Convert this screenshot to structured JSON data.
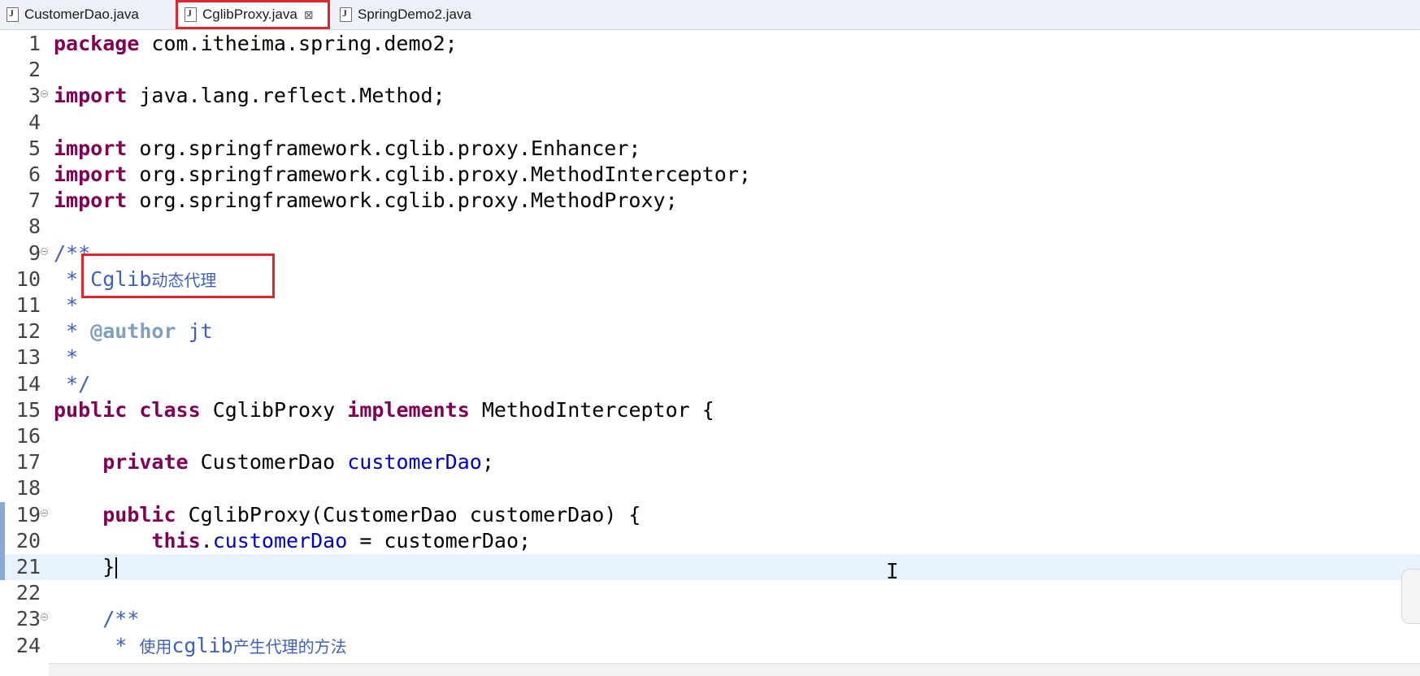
{
  "tabs": [
    {
      "label": "CustomerDao.java"
    },
    {
      "label": "CglibProxy.java",
      "close": "⊠"
    },
    {
      "label": "SpringDemo2.java"
    }
  ],
  "lines": [
    {
      "n": "1",
      "t": [
        [
          "kw",
          "package"
        ],
        [
          "p",
          " com.itheima.spring.demo2;"
        ]
      ]
    },
    {
      "n": "2",
      "t": []
    },
    {
      "n": "3",
      "t": [
        [
          "kw",
          "import"
        ],
        [
          "p",
          " java.lang.reflect.Method;"
        ]
      ]
    },
    {
      "n": "4",
      "t": []
    },
    {
      "n": "5",
      "t": [
        [
          "kw",
          "import"
        ],
        [
          "p",
          " org.springframework.cglib.proxy.Enhancer;"
        ]
      ]
    },
    {
      "n": "6",
      "t": [
        [
          "kw",
          "import"
        ],
        [
          "p",
          " org.springframework.cglib.proxy.MethodInterceptor;"
        ]
      ]
    },
    {
      "n": "7",
      "t": [
        [
          "kw",
          "import"
        ],
        [
          "p",
          " org.springframework.cglib.proxy.MethodProxy;"
        ]
      ]
    },
    {
      "n": "8",
      "t": []
    },
    {
      "n": "9",
      "t": [
        [
          "cmt",
          "/**"
        ]
      ]
    },
    {
      "n": "10",
      "t": [
        [
          "cmt",
          " * "
        ],
        [
          "cmt",
          "Cglib"
        ],
        [
          "cmtcjk",
          "动态代理"
        ]
      ]
    },
    {
      "n": "11",
      "t": [
        [
          "cmt",
          " *"
        ]
      ]
    },
    {
      "n": "12",
      "t": [
        [
          "cmt",
          " * "
        ],
        [
          "tag",
          "@author"
        ],
        [
          "cmt",
          " jt"
        ]
      ]
    },
    {
      "n": "13",
      "t": [
        [
          "cmt",
          " *"
        ]
      ]
    },
    {
      "n": "14",
      "t": [
        [
          "cmt",
          " */"
        ]
      ]
    },
    {
      "n": "15",
      "t": [
        [
          "kw",
          "public"
        ],
        [
          "p",
          " "
        ],
        [
          "kw",
          "class"
        ],
        [
          "p",
          " CglibProxy "
        ],
        [
          "kw",
          "implements"
        ],
        [
          "p",
          " MethodInterceptor {"
        ]
      ]
    },
    {
      "n": "16",
      "t": []
    },
    {
      "n": "17",
      "t": [
        [
          "p",
          "    "
        ],
        [
          "kw",
          "private"
        ],
        [
          "p",
          " CustomerDao "
        ],
        [
          "field",
          "customerDao"
        ],
        [
          "p",
          ";"
        ]
      ]
    },
    {
      "n": "18",
      "t": []
    },
    {
      "n": "19",
      "t": [
        [
          "p",
          "    "
        ],
        [
          "kw",
          "public"
        ],
        [
          "p",
          " CglibProxy(CustomerDao customerDao) {"
        ]
      ]
    },
    {
      "n": "20",
      "t": [
        [
          "p",
          "        "
        ],
        [
          "kw",
          "this"
        ],
        [
          "p",
          "."
        ],
        [
          "field",
          "customerDao"
        ],
        [
          "p",
          " = customerDao;"
        ]
      ]
    },
    {
      "n": "21",
      "t": [
        [
          "p",
          "    }"
        ]
      ]
    },
    {
      "n": "22",
      "t": []
    },
    {
      "n": "23",
      "t": [
        [
          "p",
          "    "
        ],
        [
          "cmt",
          "/**"
        ]
      ]
    },
    {
      "n": "24",
      "t": [
        [
          "cmt",
          "     * "
        ],
        [
          "cmtcjk",
          "使用"
        ],
        [
          "cmt",
          "cglib"
        ],
        [
          "cmtcjk",
          "产生代理的方法"
        ]
      ]
    }
  ]
}
